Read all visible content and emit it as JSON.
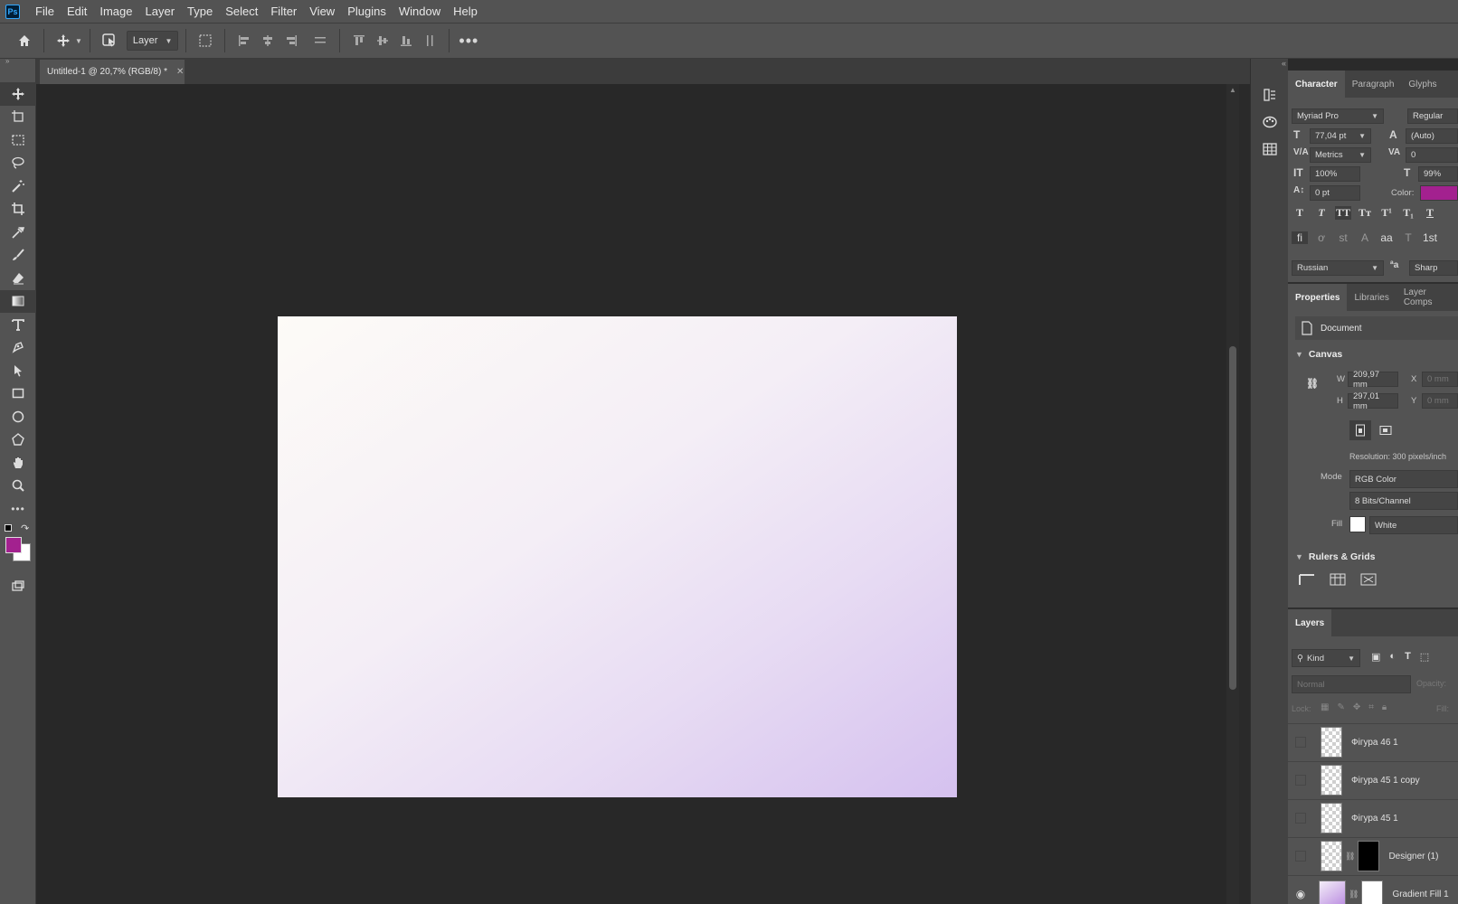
{
  "app": {
    "logo": "Ps"
  },
  "menu": [
    "File",
    "Edit",
    "Image",
    "Layer",
    "Type",
    "Select",
    "Filter",
    "View",
    "Plugins",
    "Window",
    "Help"
  ],
  "options": {
    "auto_select_target": "Layer"
  },
  "document_tab": {
    "title": "Untitled-1 @ 20,7% (RGB/8) *"
  },
  "colors": {
    "foreground": "#a3218f",
    "background": "#ffffff"
  },
  "character": {
    "tabs": [
      "Character",
      "Paragraph",
      "Glyphs"
    ],
    "font_family": "Myriad Pro",
    "font_style": "Regular",
    "size": "77,04 pt",
    "leading": "(Auto)",
    "kerning": "Metrics",
    "tracking": "0",
    "vertical_scale": "100%",
    "horizontal_scale": "99%",
    "baseline_shift": "0 pt",
    "color_label": "Color:",
    "language": "Russian",
    "antialias": "Sharp"
  },
  "properties": {
    "tabs": [
      "Properties",
      "Libraries",
      "Layer Comps"
    ],
    "doc_label": "Document",
    "canvas_label": "Canvas",
    "w_label": "W",
    "w_value": "209,97 mm",
    "h_label": "H",
    "h_value": "297,01 mm",
    "x_label": "X",
    "x_value": "0 mm",
    "y_label": "Y",
    "y_value": "0 mm",
    "resolution": "Resolution: 300 pixels/inch",
    "mode_label": "Mode",
    "mode_value": "RGB Color",
    "bits_value": "8 Bits/Channel",
    "fill_label": "Fill",
    "fill_value": "White",
    "rulers_label": "Rulers & Grids"
  },
  "layers": {
    "title": "Layers",
    "filter_kind": "Kind",
    "blend_mode": "Normal",
    "opacity_label": "Opacity:",
    "lock_label": "Lock:",
    "fill_label": "Fill:",
    "items": [
      {
        "name": "Фігура 46 1"
      },
      {
        "name": "Фігура 45 1 copy"
      },
      {
        "name": "Фігура 45 1"
      },
      {
        "name": "Designer (1)"
      },
      {
        "name": "Gradient Fill 1"
      }
    ]
  }
}
